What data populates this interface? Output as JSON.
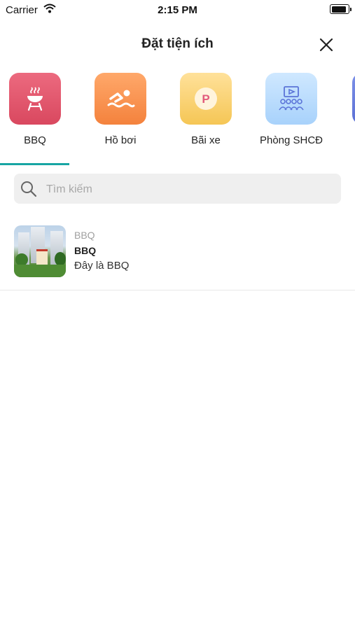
{
  "status_bar": {
    "carrier": "Carrier",
    "time": "2:15 PM"
  },
  "header": {
    "title": "Đặt tiện ích",
    "close_icon": "close-icon"
  },
  "tabs": [
    {
      "label": "BBQ",
      "icon": "grill-icon",
      "color": "#e05a70",
      "selected": true
    },
    {
      "label": "Hồ bơi",
      "icon": "swimmer-icon",
      "color": "#f99250",
      "selected": false
    },
    {
      "label": "Bãi xe",
      "icon": "parking-icon",
      "color": "#f8d06b",
      "selected": false
    },
    {
      "label": "Phòng SHCĐ",
      "icon": "meeting-room-icon",
      "color": "#b9dcfd",
      "selected": false
    },
    {
      "label": "",
      "icon": "more-category-icon",
      "color": "#6a7ee0",
      "selected": false
    }
  ],
  "active_tab_color": "#17a5a3",
  "search": {
    "placeholder": "Tìm kiếm",
    "value": ""
  },
  "results": [
    {
      "type": "BBQ",
      "name": "BBQ",
      "description": "Đây là BBQ",
      "thumbnail": "playground-photo"
    }
  ]
}
